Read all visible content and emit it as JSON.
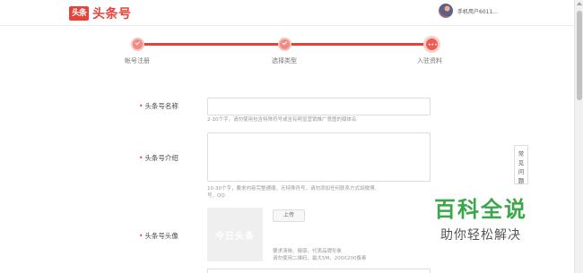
{
  "header": {
    "logo_box": "头条",
    "logo_text": "头条号",
    "username": "手机用户6011..."
  },
  "stepper": {
    "steps": [
      {
        "label": "帐号注册"
      },
      {
        "label": "选择类型"
      },
      {
        "label": "入驻资料"
      }
    ],
    "current_dots": "•••"
  },
  "form": {
    "name": {
      "label": "头条号名称",
      "value": "",
      "hint": "2-10个字，请勿使用包含特殊符号或含有明显营销推广意图的媒体名"
    },
    "intro": {
      "label": "头条号介绍",
      "value": "",
      "hint_line1": "10-30个字，要求内容完整通顺，无特殊符号，请勿添加任何联系方式如微博、",
      "hint_line2": "号、QQ"
    },
    "avatar": {
      "label": "头条号头像",
      "placeholder": "今日头条",
      "upload_label": "上传",
      "hint_line1": "要求清晰、健康，代表品牌形象",
      "hint_line2": "请勿使用二维码，最大5M，200X200像素"
    }
  },
  "help": {
    "label": "常见问题"
  },
  "watermark": {
    "title": "百科全说",
    "subtitle": "助你轻松解决"
  },
  "colors": {
    "brand": "#e8413a",
    "watermark_green": "#3aa84a"
  }
}
